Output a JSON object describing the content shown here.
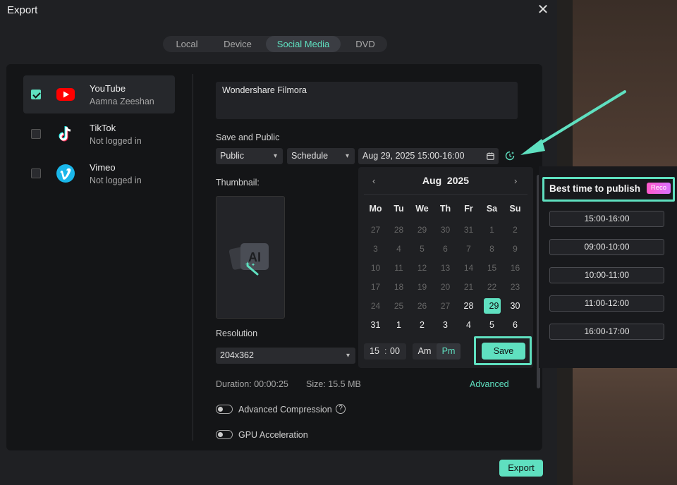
{
  "dialog": {
    "title": "Export"
  },
  "tabs": [
    {
      "label": "Local"
    },
    {
      "label": "Device"
    },
    {
      "label": "Social Media"
    },
    {
      "label": "DVD"
    }
  ],
  "platforms": [
    {
      "name": "YouTube",
      "user": "Aamna Zeeshan",
      "checked": true,
      "icon": "youtube-icon"
    },
    {
      "name": "TikTok",
      "user": "Not logged in",
      "checked": false,
      "icon": "tiktok-icon"
    },
    {
      "name": "Vimeo",
      "user": "Not logged in",
      "checked": false,
      "icon": "vimeo-icon"
    }
  ],
  "description": {
    "value": "Wondershare Filmora"
  },
  "save_public": {
    "label": "Save and Public",
    "visibility": "Public",
    "mode": "Schedule",
    "datetime": "Aug 29, 2025  15:00-16:00"
  },
  "thumbnail": {
    "label": "Thumbnail:",
    "icon": "ai-image-icon"
  },
  "resolution": {
    "label": "Resolution",
    "value": "204x362"
  },
  "info": {
    "duration": "Duration: 00:00:25",
    "size": "Size:  15.5 MB",
    "advanced": "Advanced"
  },
  "options": {
    "advanced_compression": "Advanced Compression",
    "gpu_acceleration": "GPU Acceleration"
  },
  "export_label": "Export",
  "calendar": {
    "month": "Aug",
    "year": "2025",
    "weekdays": [
      "Mo",
      "Tu",
      "We",
      "Th",
      "Fr",
      "Sa",
      "Su"
    ],
    "weeks": [
      [
        [
          "27",
          0
        ],
        [
          "28",
          0
        ],
        [
          "29",
          0
        ],
        [
          "30",
          0
        ],
        [
          "31",
          0
        ],
        [
          "1",
          0
        ],
        [
          "2",
          0
        ]
      ],
      [
        [
          "3",
          0
        ],
        [
          "4",
          0
        ],
        [
          "5",
          0
        ],
        [
          "6",
          0
        ],
        [
          "7",
          0
        ],
        [
          "8",
          0
        ],
        [
          "9",
          0
        ]
      ],
      [
        [
          "10",
          0
        ],
        [
          "11",
          0
        ],
        [
          "12",
          0
        ],
        [
          "13",
          0
        ],
        [
          "14",
          0
        ],
        [
          "15",
          0
        ],
        [
          "16",
          0
        ]
      ],
      [
        [
          "17",
          0
        ],
        [
          "18",
          0
        ],
        [
          "19",
          0
        ],
        [
          "20",
          0
        ],
        [
          "21",
          0
        ],
        [
          "22",
          0
        ],
        [
          "23",
          0
        ]
      ],
      [
        [
          "24",
          0
        ],
        [
          "25",
          0
        ],
        [
          "26",
          0
        ],
        [
          "27",
          0
        ],
        [
          "28",
          1
        ],
        [
          "29",
          2
        ],
        [
          "30",
          1
        ]
      ],
      [
        [
          "31",
          1
        ],
        [
          "1",
          1
        ],
        [
          "2",
          1
        ],
        [
          "3",
          1
        ],
        [
          "4",
          1
        ],
        [
          "5",
          1
        ],
        [
          "6",
          1
        ]
      ]
    ],
    "hour": "15",
    "minute": "00",
    "am": "Am",
    "pm": "Pm",
    "save": "Save"
  },
  "best_time": {
    "title": "Best time to publish",
    "badge": "Reco",
    "slots": [
      "15:00-16:00",
      "09:00-10:00",
      "10:00-11:00",
      "11:00-12:00",
      "16:00-17:00"
    ]
  },
  "colors": {
    "accent": "#5fe0c0",
    "youtube": "#ff0000",
    "vimeo": "#1ab7ea"
  }
}
